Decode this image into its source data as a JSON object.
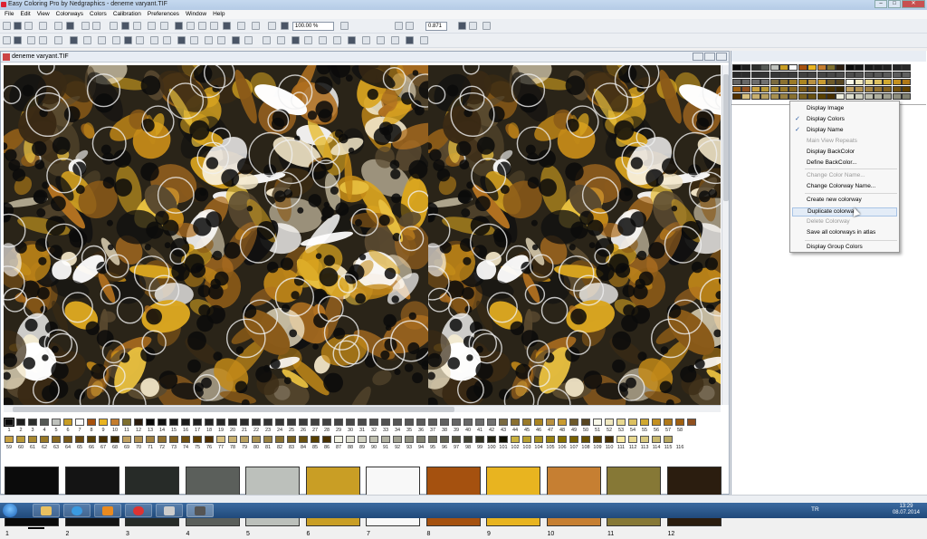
{
  "window": {
    "title": "Easy Coloring Pro by Nedgraphics - deneme varyant.TIF",
    "controls": {
      "minimize": "–",
      "maximize": "□",
      "close": "✕"
    }
  },
  "menu": [
    "File",
    "Edit",
    "View",
    "Colorways",
    "Colors",
    "Calibration",
    "Preferences",
    "Window",
    "Help"
  ],
  "toolbar": {
    "zoom_value": "100.00 %",
    "value_field": "0.871"
  },
  "document": {
    "title": "deneme varyant.TIF"
  },
  "palette": {
    "row1_colors": [
      "#0a0a0a",
      "#1e1e1e",
      "#2c2e2c",
      "#555955",
      "#bfc2bd",
      "#c89d24",
      "#f9f9f9",
      "#a6510f",
      "#e9b421",
      "#c37c2e",
      "#7e6f2e",
      "#2b1d0f",
      "#0a0a0a",
      "#121212",
      "#181818",
      "#1b1b1b",
      "#202020",
      "#242424",
      "#282828",
      "#2a2a2a",
      "#2c2c2c",
      "#303030",
      "#343434",
      "#363636",
      "#3a3a3a",
      "#3c3c3c",
      "#404040",
      "#424242",
      "#454545",
      "#484848",
      "#4b4b4b",
      "#4e4e4e",
      "#515151",
      "#545454",
      "#575757",
      "#5a5a5a",
      "#5d5d5d",
      "#606060",
      "#646464",
      "#686868",
      "#6c6c6c",
      "#707070",
      "#7a6a40",
      "#8a7030",
      "#9a7a28",
      "#aa8420",
      "#b89040",
      "#c89a30",
      "#6e5a2a",
      "#574520",
      "#f8f8e8",
      "#f0e8c0",
      "#e8d890",
      "#dcc060",
      "#d0a830",
      "#c49020",
      "#b07818",
      "#a06010",
      "#905020"
    ],
    "row1_numbers": [
      "1",
      "2",
      "3",
      "4",
      "5",
      "6",
      "7",
      "8",
      "9",
      "10",
      "11",
      "12",
      "13",
      "14",
      "15",
      "16",
      "17",
      "18",
      "19",
      "20",
      "21",
      "22",
      "23",
      "24",
      "25",
      "26",
      "27",
      "28",
      "29",
      "30",
      "31",
      "32",
      "33",
      "34",
      "35",
      "36",
      "37",
      "38",
      "39",
      "40",
      "41",
      "42",
      "43",
      "44",
      "45",
      "46",
      "47",
      "48",
      "49",
      "50",
      "51",
      "52",
      "53",
      "54",
      "55",
      "56",
      "57",
      "58"
    ],
    "row2_colors": [
      "#c8a040",
      "#b89838",
      "#a88830",
      "#987828",
      "#886820",
      "#785818",
      "#684810",
      "#584008",
      "#483000",
      "#3a2800",
      "#c0a060",
      "#b09050",
      "#a08040",
      "#907030",
      "#806020",
      "#705010",
      "#604000",
      "#503000",
      "#d8c080",
      "#c8b070",
      "#b8a060",
      "#a89050",
      "#988040",
      "#887030",
      "#786020",
      "#685010",
      "#584000",
      "#483000",
      "#f0f0e0",
      "#e0e0d0",
      "#d0d0c0",
      "#c0c0b0",
      "#b0b0a0",
      "#a0a090",
      "#909080",
      "#808070",
      "#707060",
      "#606050",
      "#505040",
      "#404030",
      "#303020",
      "#202010",
      "#101000",
      "#c8b040",
      "#b8a030",
      "#a89020",
      "#988010",
      "#887000",
      "#786000",
      "#685000",
      "#584000",
      "#483000",
      "#f8e8a0",
      "#e8d890",
      "#d8c880",
      "#c8b870",
      "#b8a860"
    ],
    "row2_numbers": [
      "59",
      "60",
      "61",
      "62",
      "63",
      "64",
      "65",
      "66",
      "67",
      "68",
      "69",
      "70",
      "71",
      "72",
      "73",
      "74",
      "75",
      "76",
      "77",
      "78",
      "79",
      "80",
      "81",
      "82",
      "83",
      "84",
      "85",
      "86",
      "87",
      "88",
      "89",
      "90",
      "91",
      "92",
      "93",
      "94",
      "95",
      "96",
      "97",
      "98",
      "99",
      "100",
      "101",
      "102",
      "103",
      "104",
      "105",
      "106",
      "107",
      "108",
      "109",
      "110",
      "111",
      "112",
      "113",
      "114",
      "115",
      "116"
    ]
  },
  "main_colors": [
    {
      "num": "1",
      "color": "#0b0b0b"
    },
    {
      "num": "2",
      "color": "#141414"
    },
    {
      "num": "3",
      "color": "#272b28"
    },
    {
      "num": "4",
      "color": "#5b5f5b"
    },
    {
      "num": "5",
      "color": "#bcc0bb"
    },
    {
      "num": "6",
      "color": "#c99e25"
    },
    {
      "num": "7",
      "color": "#f8f8f8"
    },
    {
      "num": "8",
      "color": "#a5510f"
    },
    {
      "num": "9",
      "color": "#e8b420"
    },
    {
      "num": "10",
      "color": "#c67f32"
    },
    {
      "num": "11",
      "color": "#867836"
    },
    {
      "num": "12",
      "color": "#2b1d0f"
    }
  ],
  "context_menu": {
    "items": [
      {
        "label": "Display Image",
        "checked": false,
        "disabled": false
      },
      {
        "label": "Display Colors",
        "checked": true,
        "disabled": false
      },
      {
        "label": "Display Name",
        "checked": true,
        "disabled": false
      },
      {
        "label": "Main View Repeats",
        "checked": false,
        "disabled": true
      },
      {
        "label": "Display BackColor",
        "checked": false,
        "disabled": false
      },
      {
        "label": "Define BackColor...",
        "checked": false,
        "disabled": false
      },
      {
        "label": "Change Color Name...",
        "checked": false,
        "disabled": true
      },
      {
        "label": "Change Colorway Name...",
        "checked": false,
        "disabled": false
      },
      {
        "label": "Create new colorway",
        "checked": false,
        "disabled": false
      },
      {
        "label": "Duplicate colorway",
        "checked": false,
        "disabled": false,
        "hover": true
      },
      {
        "label": "Delete Colorway",
        "checked": false,
        "disabled": true
      },
      {
        "label": "Save all colorways in atlas",
        "checked": false,
        "disabled": false
      },
      {
        "label": "Display Group Colors",
        "checked": false,
        "disabled": false
      }
    ]
  },
  "taskbar": {
    "language": "TR",
    "time": "13:29",
    "date": "08.07.2014"
  },
  "icons": [
    "start-orb-icon",
    "explorer-folder-icon",
    "internet-explorer-icon",
    "media-player-icon",
    "chrome-icon",
    "camera-app-icon",
    "easy-coloring-app-icon"
  ]
}
